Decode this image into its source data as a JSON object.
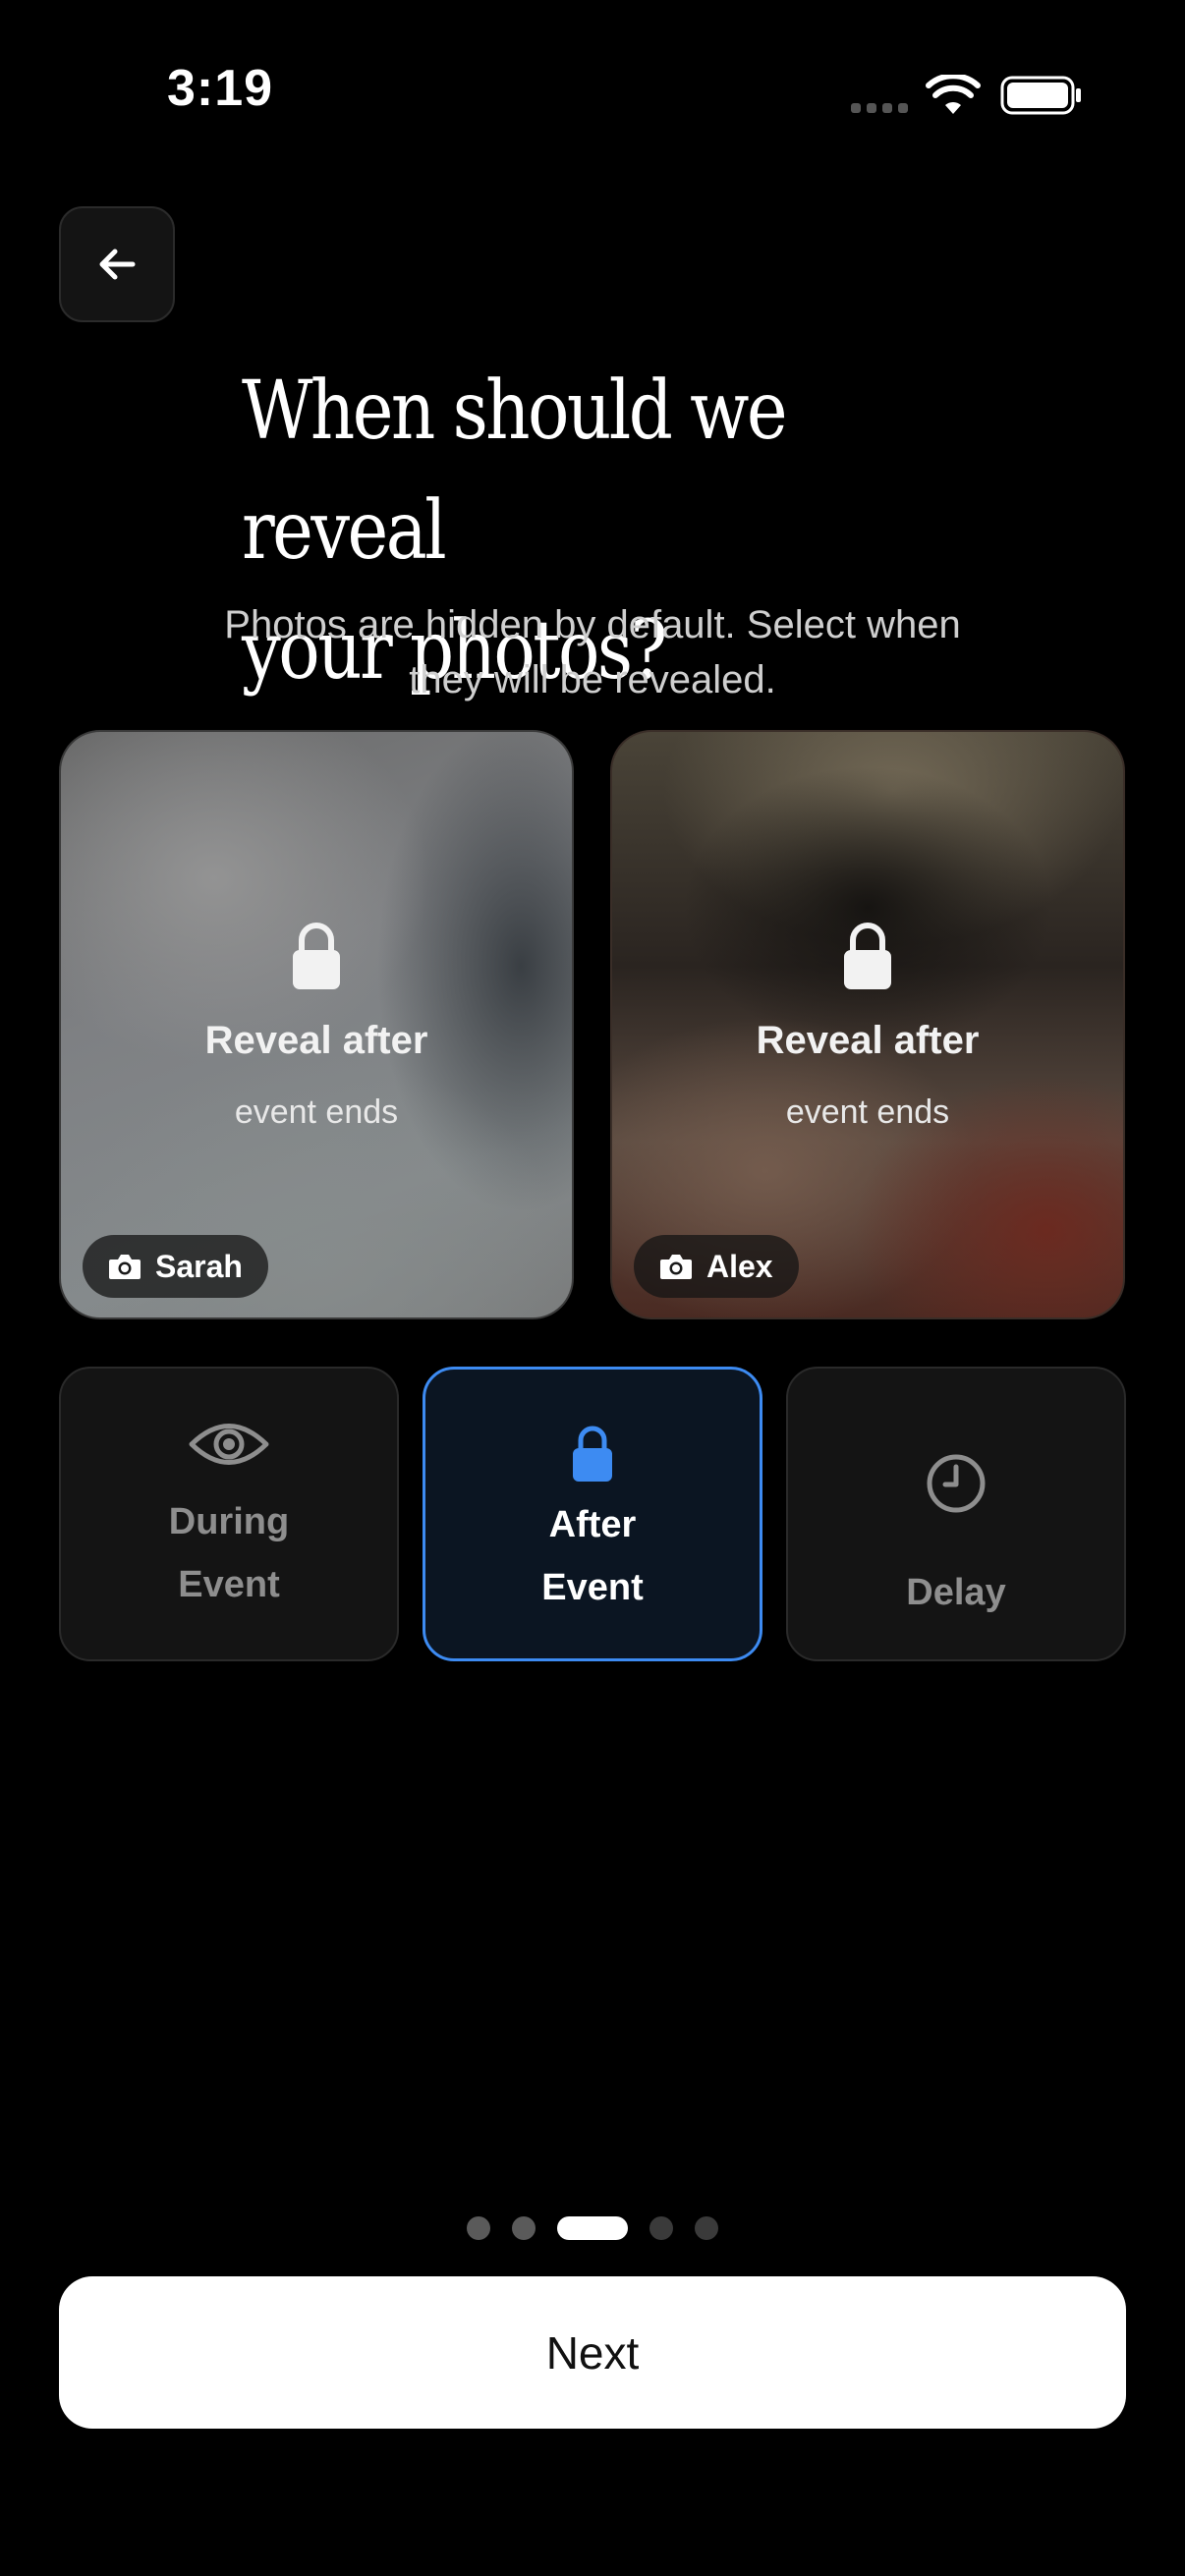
{
  "status_bar": {
    "time": "3:19"
  },
  "header": {
    "back_icon": "arrow-left-icon"
  },
  "title": {
    "line1": "When should we reveal",
    "line2": "your photos?"
  },
  "subtitle": {
    "line1": "Photos are hidden by default. Select when",
    "line2": "they will be revealed."
  },
  "preview_cards": [
    {
      "icon": "lock-icon",
      "title": "Reveal after",
      "subtitle": "event ends",
      "name_icon": "camera-icon",
      "name": "Sarah"
    },
    {
      "icon": "lock-icon",
      "title": "Reveal after",
      "subtitle": "event ends",
      "name_icon": "camera-icon",
      "name": "Alex"
    }
  ],
  "options": [
    {
      "icon": "eye-icon",
      "line1": "During",
      "line2": "Event",
      "selected": false
    },
    {
      "icon": "lock-icon",
      "line1": "After",
      "line2": "Event",
      "selected": true
    },
    {
      "icon": "clock-icon",
      "line1": "Delay",
      "selected": false
    }
  ],
  "pagination": {
    "total": 5,
    "current": 3
  },
  "footer": {
    "next_label": "Next"
  },
  "colors": {
    "background": "#000000",
    "accent": "#3d8bf2",
    "selected_tile_bg": "#0b1522",
    "tile_bg": "#141414",
    "button_bg": "#ffffff"
  }
}
